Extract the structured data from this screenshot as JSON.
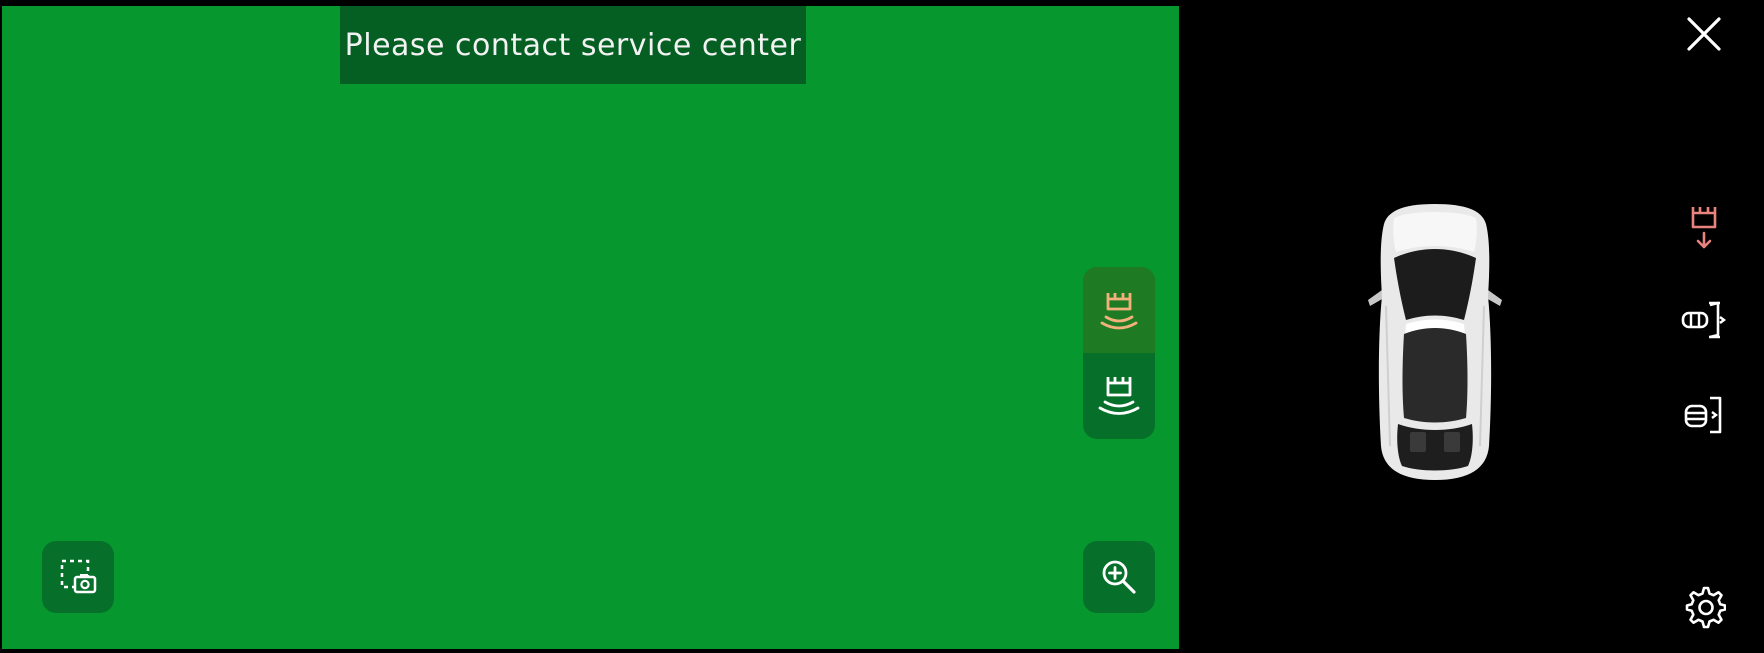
{
  "camera": {
    "warning_message": "Please contact service center",
    "background_color": "#06982f",
    "buttons": {
      "screenshot_icon": "camera-capture-icon",
      "zoom_icon": "zoom-in-icon",
      "front_sensor_icon": "front-sensor-icon",
      "rear_sensor_icon": "rear-sensor-icon"
    }
  },
  "side_panel": {
    "close_icon": "close-icon",
    "parking_alert_icon": "parking-sensor-alert-icon",
    "mirror_icon_1": "mirror-fold-icon",
    "mirror_icon_2": "mirror-unfold-icon",
    "settings_icon": "gear-icon"
  },
  "colors": {
    "alert": "#e8837d",
    "active_sensor": "#f0b27a",
    "icon": "#ffffff"
  }
}
